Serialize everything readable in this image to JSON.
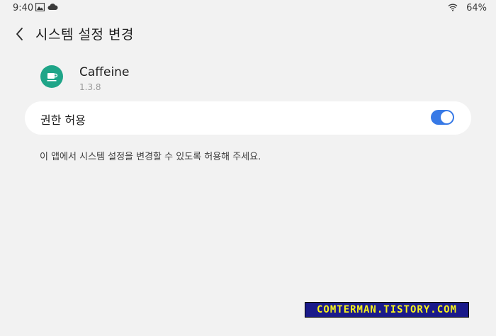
{
  "status_bar": {
    "time": "9:40",
    "battery": "64%",
    "icons": [
      "image-icon",
      "cloud-icon",
      "wifi-icon"
    ]
  },
  "header": {
    "title": "시스템 설정 변경",
    "back_icon": "chevron-left-icon"
  },
  "app": {
    "name": "Caffeine",
    "version": "1.3.8",
    "icon": "coffee-cup-icon",
    "icon_color": "#1fa588"
  },
  "permission": {
    "label": "권한 허용",
    "enabled": true,
    "toggle_color": "#3779e6"
  },
  "description": "이 앱에서 시스템 설정을 변경할 수 있도록 허용해 주세요.",
  "watermark": "COMTERMAN.TISTORY.COM"
}
